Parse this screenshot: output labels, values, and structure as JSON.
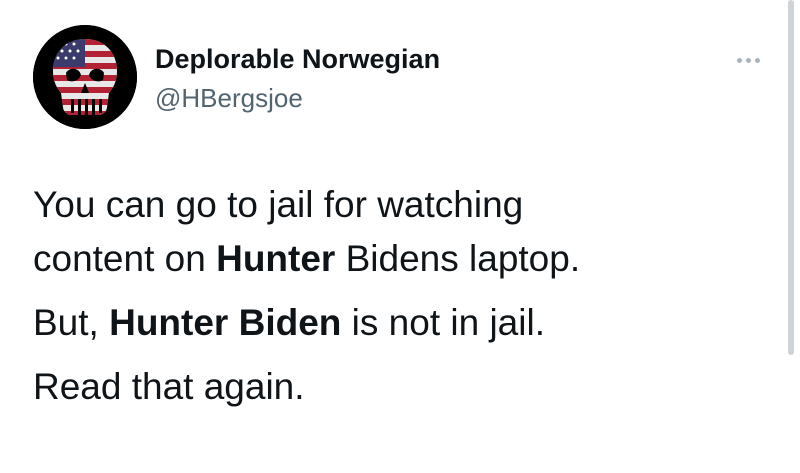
{
  "author": {
    "display_name": "Deplorable Norwegian",
    "handle": "@HBergsjoe",
    "avatar_icon": "punisher-skull-flag-icon"
  },
  "more_icon": "more-options-icon",
  "tweet": {
    "p1": {
      "a": "You can go to jail for watching",
      "b": "content on ",
      "c": "Hunter",
      "d": " Bidens laptop."
    },
    "p2": {
      "a": "But, ",
      "b": "Hunter Biden",
      "c": " is not in jail."
    },
    "p3": {
      "a": "Read that again."
    }
  },
  "colors": {
    "text": "#0f1419",
    "secondary": "#536471",
    "more_dots": "#a8b3bd"
  }
}
